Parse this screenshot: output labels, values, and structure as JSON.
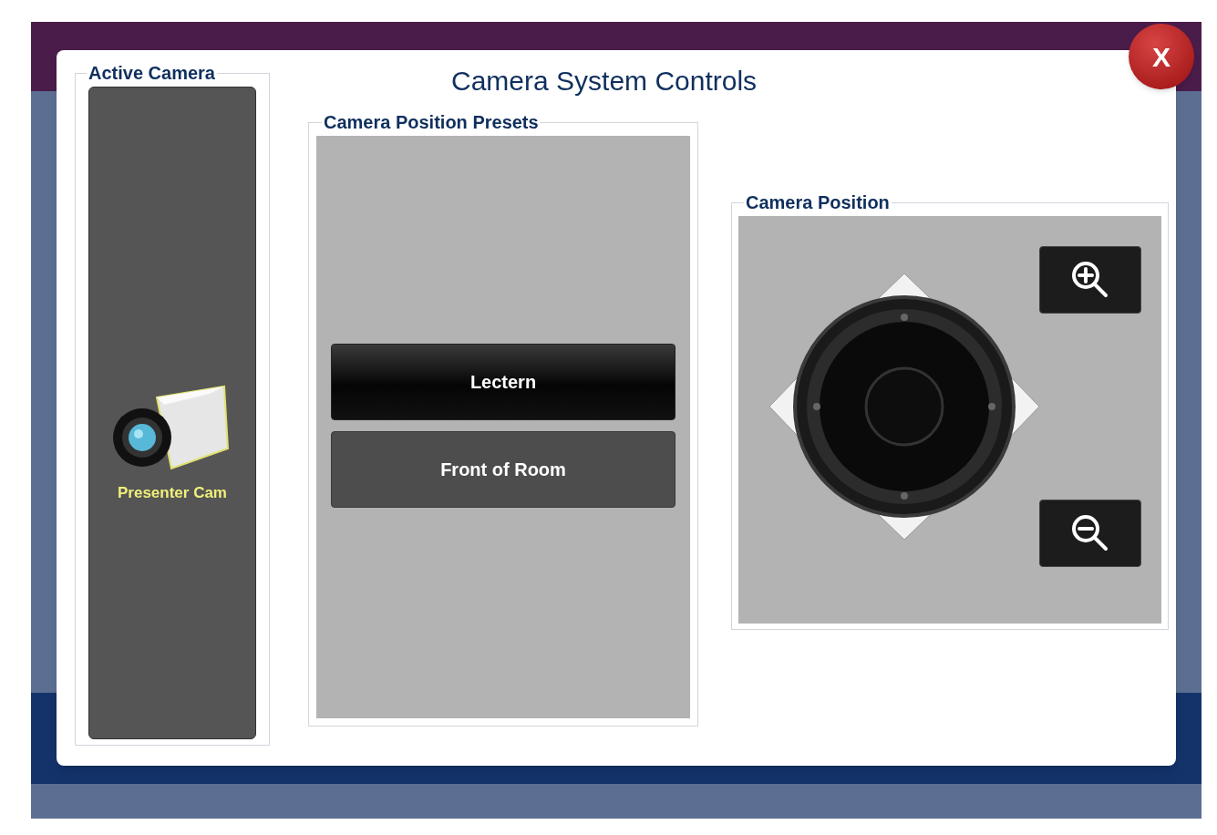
{
  "dialog": {
    "title": "Camera System Controls",
    "close_label": "X"
  },
  "active_camera": {
    "title": "Active Camera",
    "cameras": [
      {
        "label": "Presenter Cam",
        "selected": true
      }
    ]
  },
  "presets": {
    "title": "Camera Position Presets",
    "items": [
      {
        "label": "Lectern",
        "selected": true
      },
      {
        "label": "Front of Room",
        "selected": false
      }
    ]
  },
  "position": {
    "title": "Camera Position"
  }
}
